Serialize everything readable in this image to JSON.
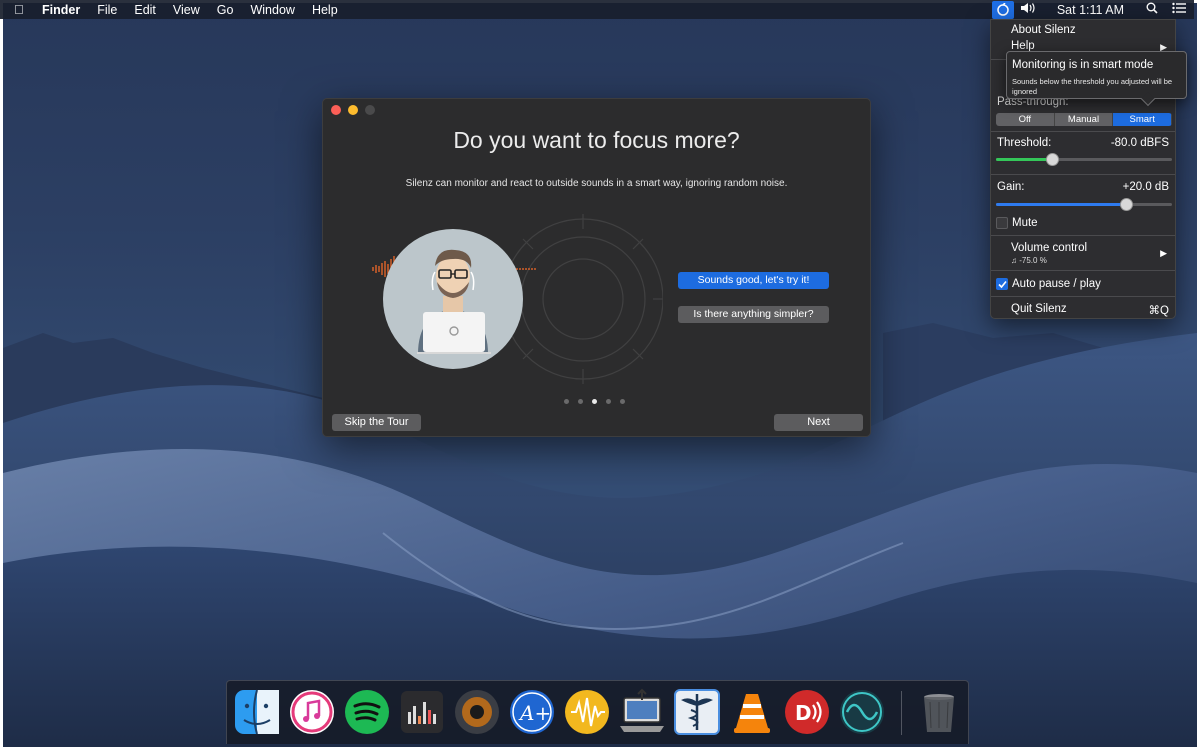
{
  "menubar": {
    "app_name": "Finder",
    "menus": [
      "File",
      "Edit",
      "View",
      "Go",
      "Window",
      "Help"
    ],
    "clock": "Sat 1:11 AM",
    "status_icons": [
      "silenz-icon",
      "volume-icon",
      "spotlight-icon",
      "notification-list-icon"
    ]
  },
  "onboarding": {
    "title": "Do you want to focus more?",
    "subtitle": "Silenz can monitor and react to outside sounds in a smart way, ignoring random noise.",
    "primary_button": "Sounds good, let's try it!",
    "secondary_button": "Is there anything simpler?",
    "skip_button": "Skip the Tour",
    "next_button": "Next",
    "page_dots": 5,
    "active_page": 3
  },
  "silenz_menu": {
    "about": "About Silenz",
    "help": "Help",
    "pass_through_label": "Pass-through:",
    "pass_through_options": [
      "Off",
      "Manual",
      "Smart"
    ],
    "pass_through_selected": "Smart",
    "threshold_label": "Threshold:",
    "threshold_value": "-80.0 dBFS",
    "threshold_level": 0.32,
    "gain_label": "Gain:",
    "gain_value": "+20.0 dB",
    "gain_level": 0.74,
    "mute_label": "Mute",
    "mute_checked": false,
    "volume_control_label": "Volume control",
    "volume_control_value": "-75.0 %",
    "auto_pause_label": "Auto pause / play",
    "auto_pause_checked": true,
    "quit_label": "Quit Silenz",
    "quit_shortcut": "⌘Q"
  },
  "tooltip": {
    "title": "Monitoring is in smart mode",
    "body": "Sounds below the threshold you adjusted will be ignored"
  },
  "dock": {
    "apps": [
      "finder-icon",
      "itunes-icon",
      "spotify-icon",
      "equalizer-app-icon",
      "speaker-app-icon",
      "font-app-icon",
      "waveform-app-icon",
      "network-app-icon",
      "caduceus-app-icon",
      "vlc-icon",
      "podcast-app-icon",
      "sine-wave-app-icon",
      "trash-icon"
    ]
  },
  "colors": {
    "accent_blue": "#1d6ce0",
    "window_bg": "#2c2c2d",
    "threshold_green": "#34c759",
    "waveform_orange": "#e0642a"
  }
}
